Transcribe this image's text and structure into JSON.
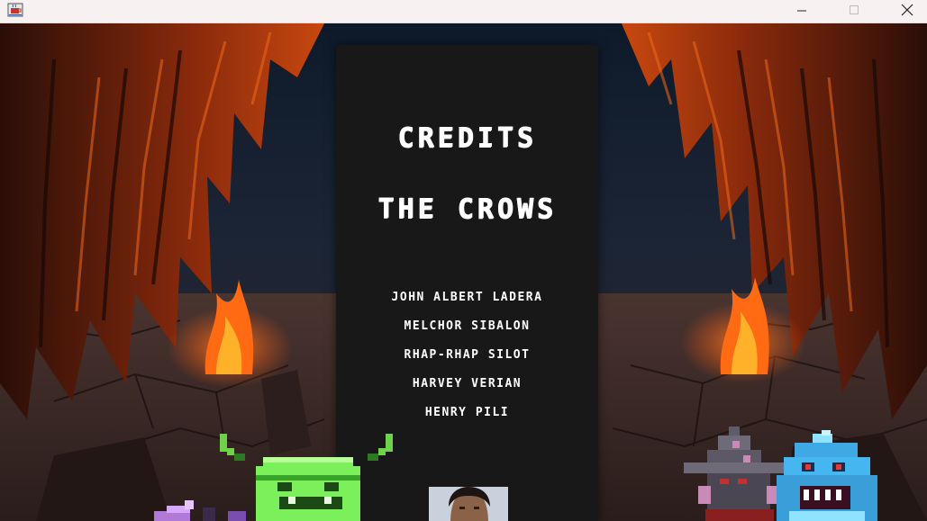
{
  "window": {
    "app_icon": "java-cup-icon",
    "controls": [
      "minimize-icon",
      "maximize-icon",
      "close-icon"
    ]
  },
  "credits": {
    "title": "CREDITS",
    "team": "THE CROWS",
    "members": [
      "JOHN ALBERT LADERA",
      "MELCHOR SIBALON",
      "RHAP-RHAP SILOT",
      "HARVEY VERIAN",
      "HENRY PILI"
    ]
  },
  "colors": {
    "panel": "#181818",
    "text": "#ffffff",
    "lava": "#ff6a1a",
    "titlebar": "#f7f1f1"
  },
  "sprites": [
    "green-goblin-sprite",
    "purple-hood-sprite",
    "grey-witch-sprite",
    "blue-ogre-sprite"
  ]
}
